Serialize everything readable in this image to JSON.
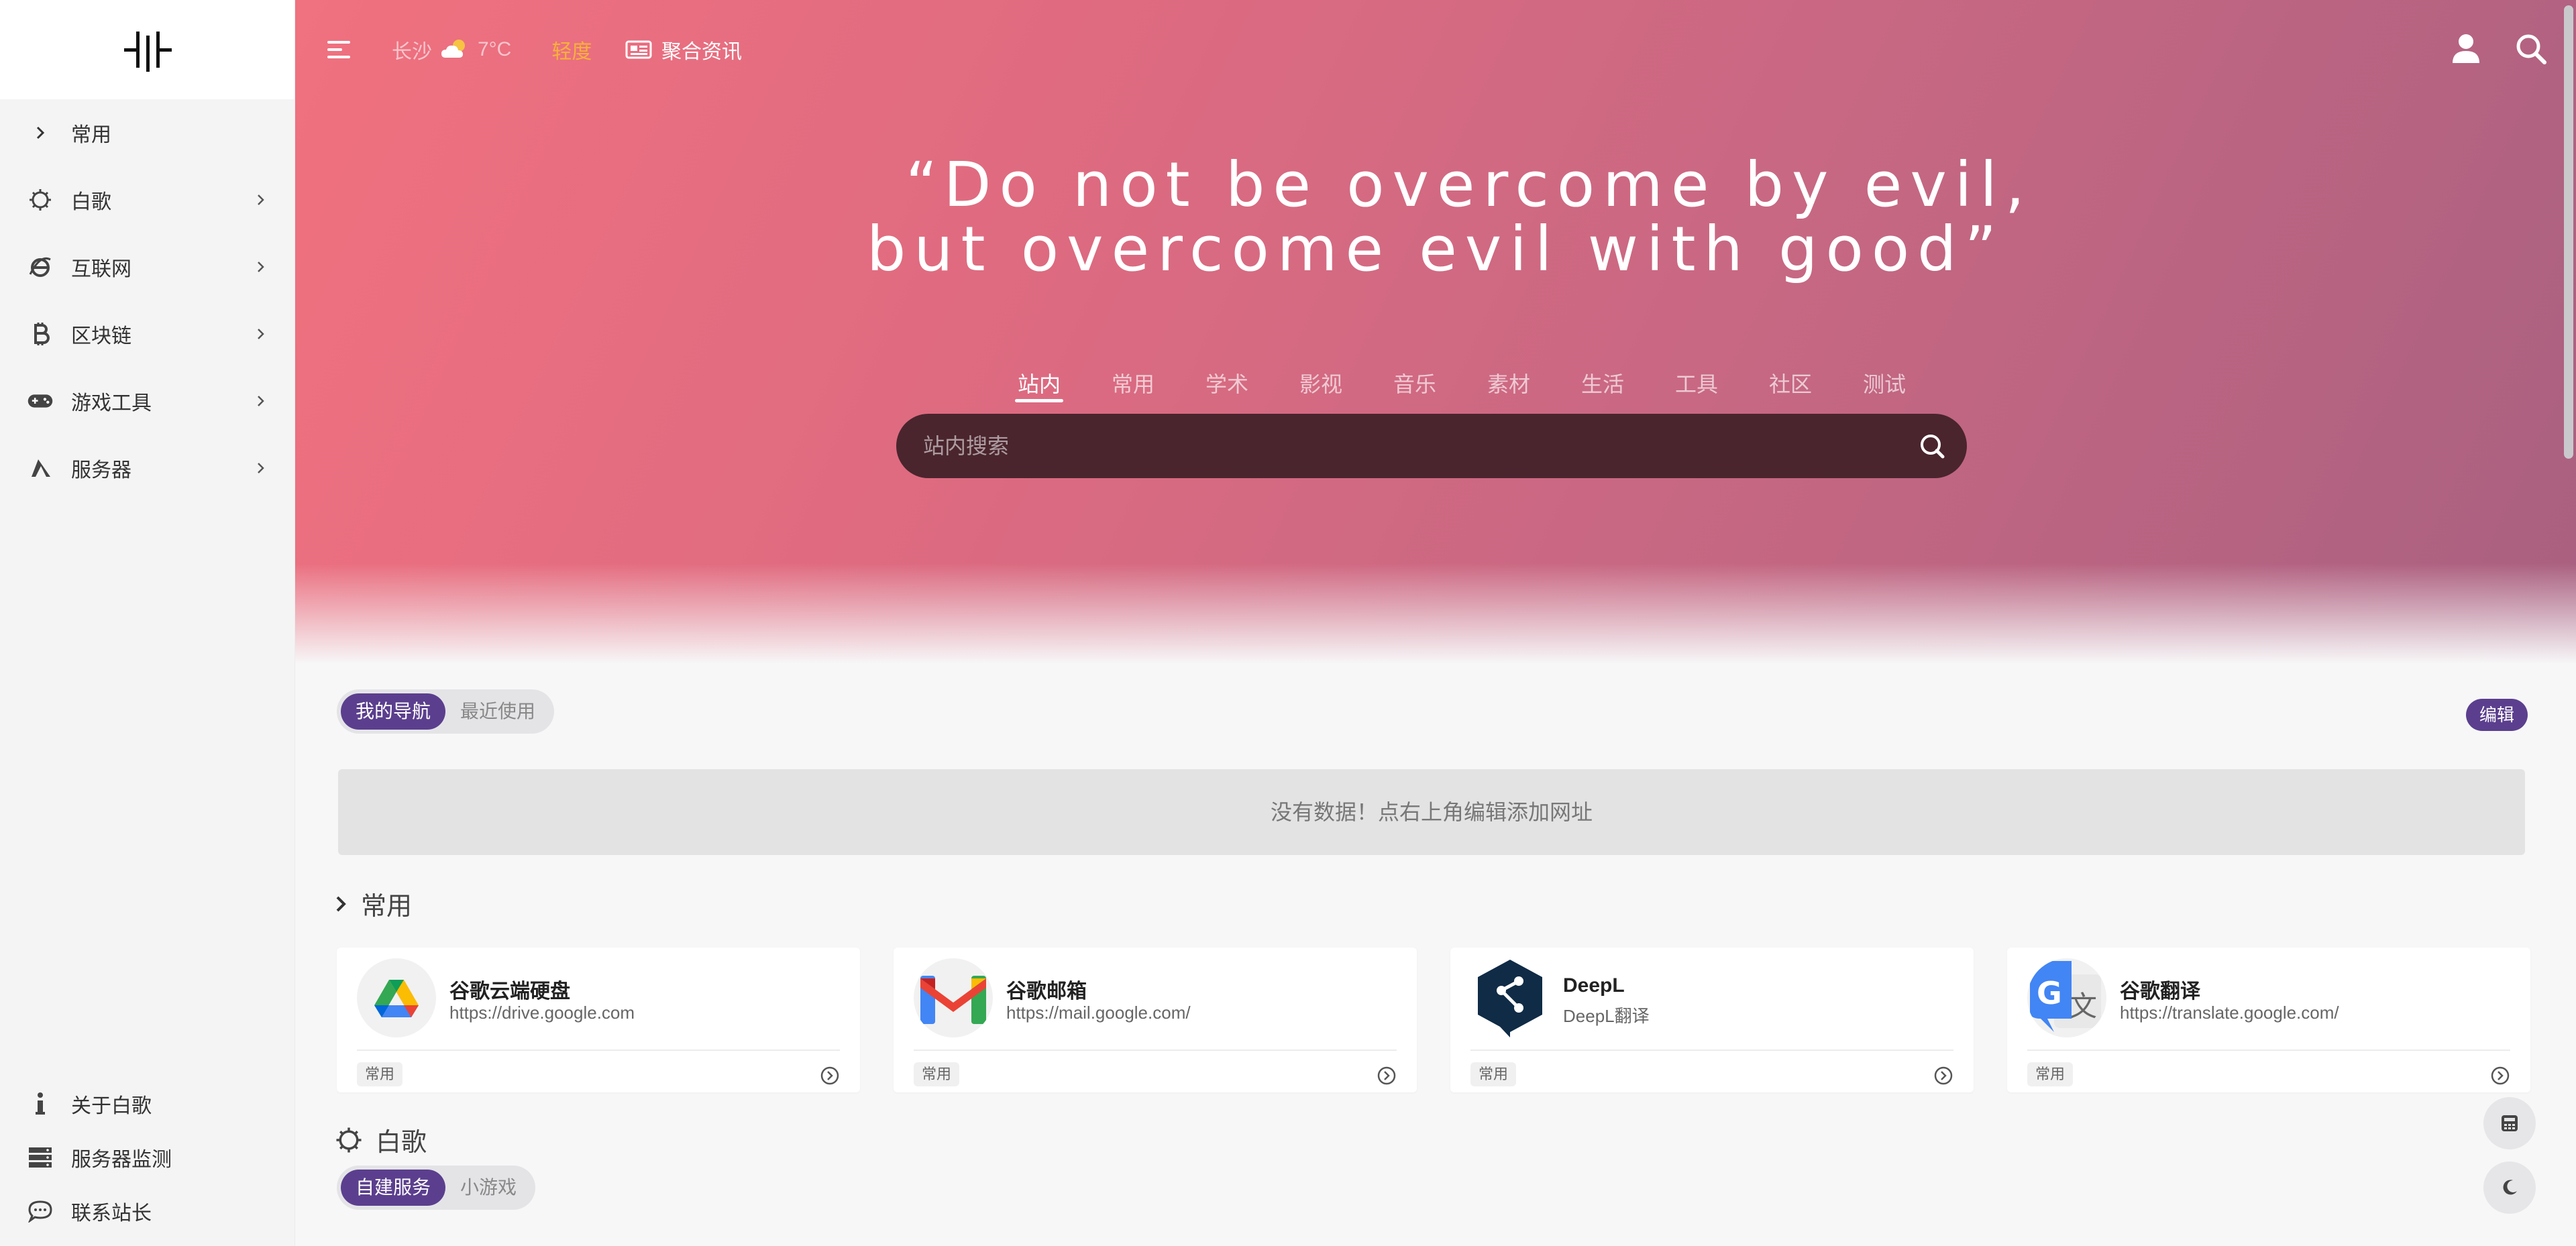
{
  "sidebar": {
    "items": [
      {
        "label": "常用",
        "icon": "chevron-right-icon"
      },
      {
        "label": "白歌",
        "icon": "gear-icon"
      },
      {
        "label": "互联网",
        "icon": "internet-explorer-icon"
      },
      {
        "label": "区块链",
        "icon": "bitcoin-icon"
      },
      {
        "label": "游戏工具",
        "icon": "gamepad-icon"
      },
      {
        "label": "服务器",
        "icon": "server-sail-icon"
      }
    ],
    "bottom": [
      {
        "label": "关于白歌",
        "icon": "info-icon"
      },
      {
        "label": "服务器监测",
        "icon": "server-rack-icon"
      },
      {
        "label": "联系站长",
        "icon": "chat-icon"
      }
    ]
  },
  "header": {
    "weather_city": "长沙",
    "weather_temp": "7°C",
    "weather_aqi": "轻度",
    "news_label": "聚合资讯"
  },
  "hero": {
    "quote_line1": "“Do not be overcome by evil,",
    "quote_line2": "but overcome evil with good”",
    "tabs": [
      "站内",
      "常用",
      "学术",
      "影视",
      "音乐",
      "素材",
      "生活",
      "工具",
      "社区",
      "测试"
    ],
    "active_tab": "站内",
    "search_placeholder": "站内搜索"
  },
  "nav_section": {
    "tabs": [
      "我的导航",
      "最近使用"
    ],
    "edit_label": "编辑",
    "empty_text": "没有数据！点右上角编辑添加网址"
  },
  "common_section": {
    "title": "常用",
    "cards": [
      {
        "title": "谷歌云端硬盘",
        "url": "https://drive.google.com",
        "tag": "常用",
        "icon": "google-drive-icon"
      },
      {
        "title": "谷歌邮箱",
        "url": "https://mail.google.com/",
        "tag": "常用",
        "icon": "gmail-icon"
      },
      {
        "title": "DeepL",
        "url": "DeepL翻译",
        "tag": "常用",
        "icon": "deepl-icon"
      },
      {
        "title": "谷歌翻译",
        "url": "https://translate.google.com/",
        "tag": "常用",
        "icon": "google-translate-icon"
      }
    ]
  },
  "baige_section": {
    "title": "白歌",
    "tabs": [
      "自建服务",
      "小游戏"
    ]
  },
  "colors": {
    "accent": "#5b3f8e",
    "aqi": "#f6b13b",
    "search_bg": "#4a252e"
  }
}
